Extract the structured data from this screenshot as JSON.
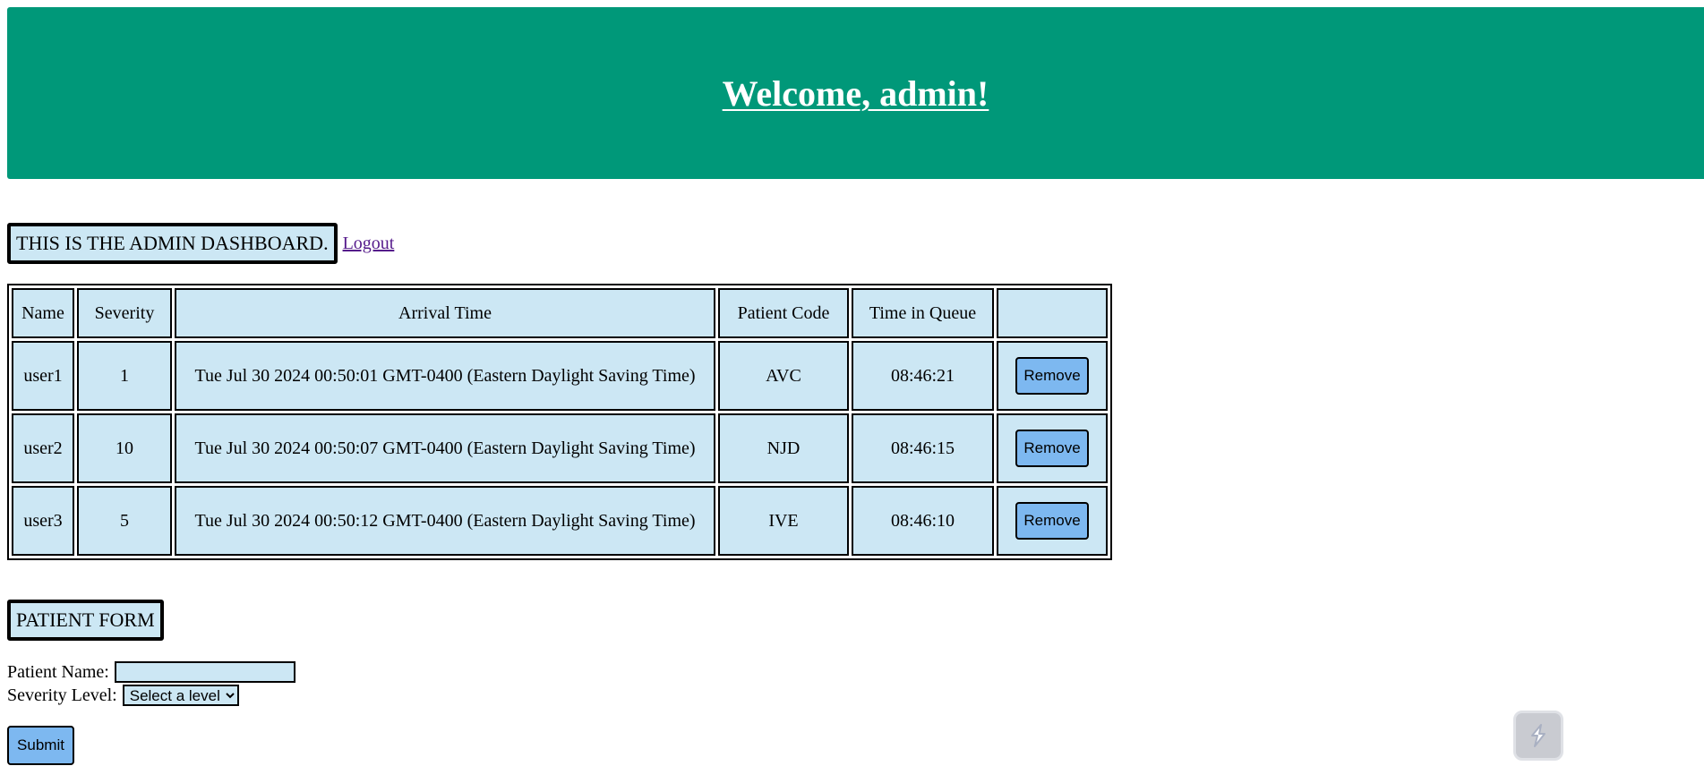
{
  "header": {
    "welcome": "Welcome, admin!"
  },
  "dashboard": {
    "label": "THIS IS THE ADMIN DASHBOARD.",
    "logout": "Logout"
  },
  "table": {
    "headers": [
      "Name",
      "Severity",
      "Arrival Time",
      "Patient Code",
      "Time in Queue",
      ""
    ],
    "rows": [
      {
        "name": "user1",
        "severity": "1",
        "arrival": "Tue Jul 30 2024 00:50:01 GMT-0400 (Eastern Daylight Saving Time)",
        "code": "AVC",
        "queue_time": "08:46:21",
        "action": "Remove"
      },
      {
        "name": "user2",
        "severity": "10",
        "arrival": "Tue Jul 30 2024 00:50:07 GMT-0400 (Eastern Daylight Saving Time)",
        "code": "NJD",
        "queue_time": "08:46:15",
        "action": "Remove"
      },
      {
        "name": "user3",
        "severity": "5",
        "arrival": "Tue Jul 30 2024 00:50:12 GMT-0400 (Eastern Daylight Saving Time)",
        "code": "IVE",
        "queue_time": "08:46:10",
        "action": "Remove"
      }
    ]
  },
  "form": {
    "title": "PATIENT FORM",
    "name_label": "Patient Name:",
    "name_value": "",
    "severity_label": "Severity Level:",
    "severity_selected": "Select a level",
    "submit": "Submit"
  },
  "widget": {
    "icon": "lightning-bolt-icon"
  },
  "colors": {
    "banner": "#009879",
    "cell_bg": "#cce7f4",
    "button_bg": "#7db8f0",
    "link": "#551a8b"
  }
}
